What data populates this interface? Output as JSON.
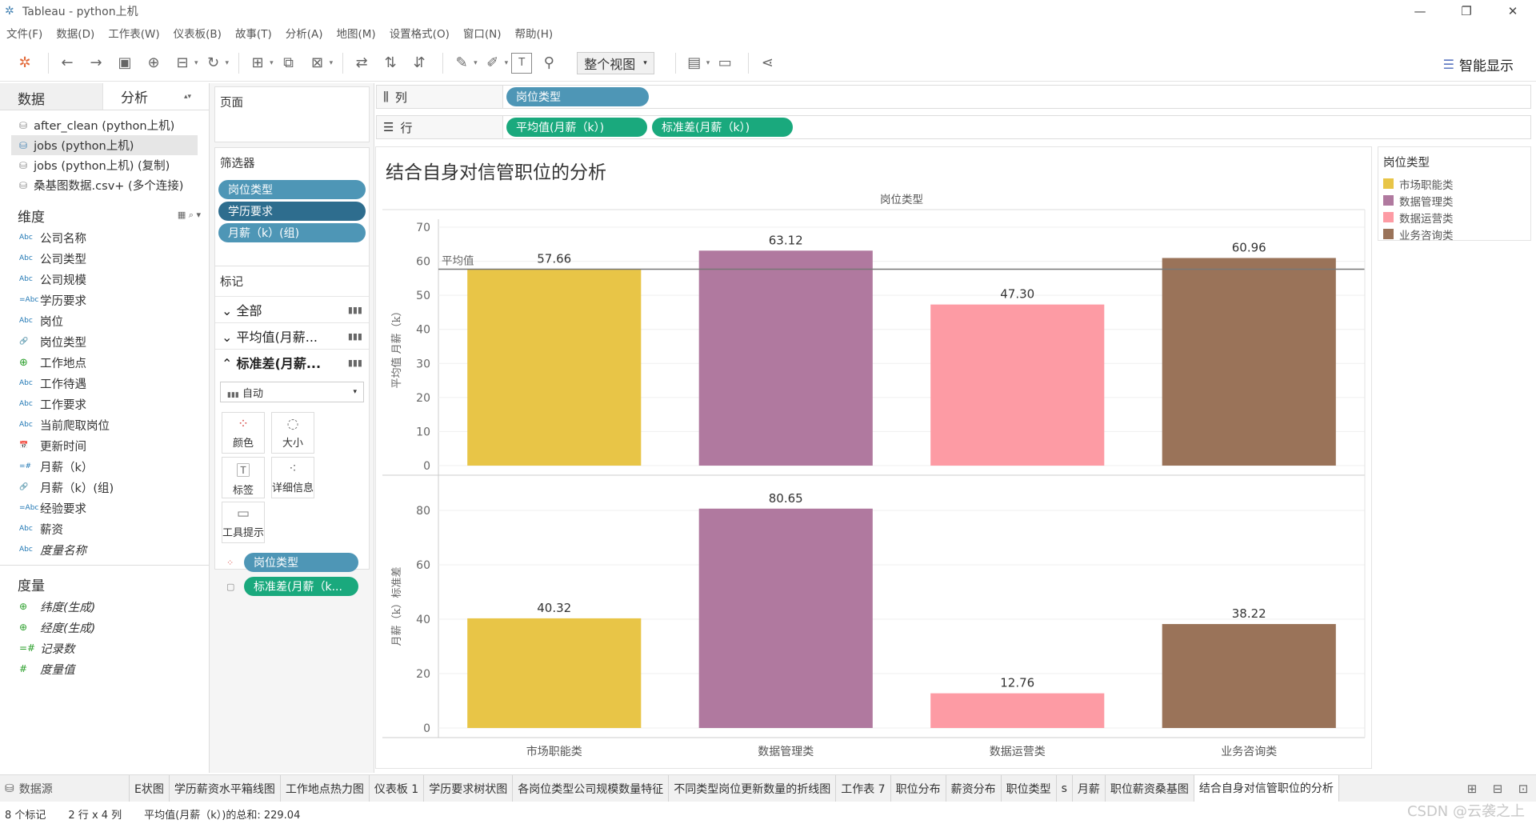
{
  "window": {
    "title": "Tableau - python上机"
  },
  "menu": [
    "文件(F)",
    "数据(D)",
    "工作表(W)",
    "仪表板(B)",
    "故事(T)",
    "分析(A)",
    "地图(M)",
    "设置格式(O)",
    "窗口(N)",
    "帮助(H)"
  ],
  "toolbar": {
    "view_mode": "整个视图",
    "smart_show": "智能显示"
  },
  "left_pane": {
    "tab_data": "数据",
    "tab_analysis": "分析",
    "datasources": [
      "after_clean (python上机)",
      "jobs (python上机)",
      "jobs (python上机) (复制)",
      "桑基图数据.csv+ (多个连接)"
    ],
    "dimensions_label": "维度",
    "dimensions": [
      {
        "type": "Abc",
        "name": "公司名称"
      },
      {
        "type": "Abc",
        "name": "公司类型"
      },
      {
        "type": "Abc",
        "name": "公司规模"
      },
      {
        "type": "=Abc",
        "name": "学历要求"
      },
      {
        "type": "Abc",
        "name": "岗位"
      },
      {
        "type": "link",
        "name": "岗位类型"
      },
      {
        "type": "globe",
        "name": "工作地点"
      },
      {
        "type": "Abc",
        "name": "工作待遇"
      },
      {
        "type": "Abc",
        "name": "工作要求"
      },
      {
        "type": "Abc",
        "name": "当前爬取岗位"
      },
      {
        "type": "date",
        "name": "更新时间"
      },
      {
        "type": "=#",
        "name": "月薪（k）"
      },
      {
        "type": "link",
        "name": "月薪（k）(组)"
      },
      {
        "type": "=Abc",
        "name": "经验要求"
      },
      {
        "type": "Abc",
        "name": "薪资"
      },
      {
        "type": "Abc",
        "name": "度量名称"
      }
    ],
    "measures_label": "度量",
    "measures": [
      {
        "type": "globe",
        "name": "纬度(生成)"
      },
      {
        "type": "globe",
        "name": "经度(生成)"
      },
      {
        "type": "=#",
        "name": "记录数"
      },
      {
        "type": "#",
        "name": "度量值"
      }
    ]
  },
  "cards": {
    "pages_label": "页面",
    "filters_label": "筛选器",
    "filters": [
      "岗位类型",
      "学历要求",
      "月薪（k）(组)"
    ],
    "marks_label": "标记",
    "marks_rows": [
      "全部",
      "平均值(月薪...",
      "标准差(月薪..."
    ],
    "mark_type": "自动",
    "mark_buttons": [
      "颜色",
      "大小",
      "标签",
      "详细信息",
      "工具提示"
    ],
    "mark_pills": [
      "岗位类型",
      "标准差(月薪（k..."
    ]
  },
  "shelves": {
    "columns_label": "列",
    "columns": [
      "岗位类型"
    ],
    "rows_label": "行",
    "rows": [
      "平均值(月薪（k）)",
      "标准差(月薪（k）)"
    ]
  },
  "legend": {
    "title": "岗位类型",
    "items": [
      {
        "name": "市场职能类",
        "color": "#e8c547"
      },
      {
        "name": "数据管理类",
        "color": "#b0799f"
      },
      {
        "name": "数据运营类",
        "color": "#fd9ba4"
      },
      {
        "name": "业务咨询类",
        "color": "#9a7359"
      }
    ]
  },
  "chart_data": {
    "title": "结合自身对信管职位的分析",
    "type": "bar",
    "column_header": "岗位类型",
    "categories": [
      "市场职能类",
      "数据管理类",
      "数据运营类",
      "业务咨询类"
    ],
    "colors": [
      "#e8c547",
      "#b0799f",
      "#fd9ba4",
      "#9a7359"
    ],
    "panels": [
      {
        "ylabel": "平均值 月薪（k）",
        "values": [
          57.66,
          63.12,
          47.3,
          60.96
        ],
        "labels": [
          "57.66",
          "63.12",
          "47.30",
          "60.96"
        ],
        "ylim": [
          0,
          70
        ],
        "yticks": [
          0,
          10,
          20,
          30,
          40,
          50,
          60,
          70
        ],
        "reference_line": {
          "label": "平均值",
          "value": 57.66
        }
      },
      {
        "ylabel": "月薪（k）标准差",
        "values": [
          40.32,
          80.65,
          12.76,
          38.22
        ],
        "labels": [
          "40.32",
          "80.65",
          "12.76",
          "38.22"
        ],
        "ylim": [
          0,
          90
        ],
        "yticks": [
          0,
          20,
          40,
          60,
          80
        ]
      }
    ],
    "grid": true
  },
  "sheet_tabs": {
    "datasource": "数据源",
    "tabs": [
      "E状图",
      "学历薪资水平箱线图",
      "工作地点热力图",
      "仪表板 1",
      "学历要求树状图",
      "各岗位类型公司规模数量特征",
      "不同类型岗位更新数量的折线图",
      "工作表 7",
      "职位分布",
      "薪资分布",
      "职位类型",
      "s",
      "月薪",
      "职位薪资桑基图",
      "结合自身对信管职位的分析"
    ],
    "active": "结合自身对信管职位的分析"
  },
  "status": {
    "marks": "8 个标记",
    "grid": "2 行 x 4 列",
    "sum": "平均值(月薪（k）)的总和: 229.04"
  },
  "watermark": "CSDN @云袭之上"
}
